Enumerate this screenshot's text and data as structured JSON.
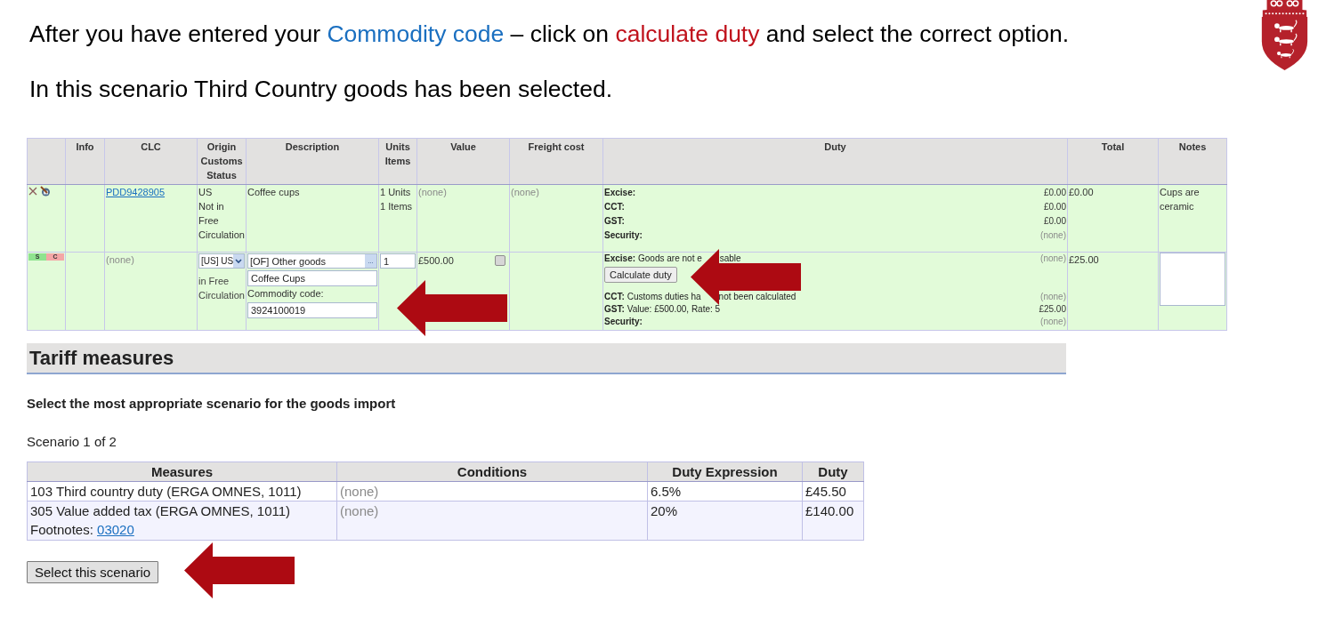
{
  "instructions": [
    {
      "segments": [
        {
          "text": "After you have entered your ",
          "color": "#000000"
        },
        {
          "text": "Commodity code",
          "color": "#1a6fc0"
        },
        {
          "text": " – click on ",
          "color": "#000000"
        },
        {
          "text": "calculate duty",
          "color": "#c0121c"
        },
        {
          "text": " and select the correct option.",
          "color": "#000000"
        }
      ]
    },
    {
      "segments": [
        {
          "text": "In this scenario Third Country goods has been selected.",
          "color": "#000000"
        }
      ]
    }
  ],
  "import_grid": {
    "columns": [
      "Info",
      "CLC",
      "Origin Customs Status",
      "Description",
      "Units Items",
      "Value",
      "Freight cost",
      "Duty",
      "Total",
      "Notes"
    ],
    "rows": [
      {
        "kind": "saved",
        "clc": "PDD9428905",
        "origin_code": "US",
        "origin_status": "Not in Free Circulation",
        "description": "Coffee cups",
        "units": "1 Units",
        "items": "1 Items",
        "value": {
          "text": "(none)",
          "muted": true
        },
        "freight": {
          "text": "(none)",
          "muted": true
        },
        "duty": [
          {
            "kind": "note",
            "label": "Excise:",
            "amount": "£0.00",
            "muted": false
          },
          {
            "kind": "note",
            "label": "CCT:",
            "amount": "£0.00",
            "muted": false
          },
          {
            "kind": "note",
            "label": "GST:",
            "amount": "£0.00",
            "muted": false
          },
          {
            "kind": "note",
            "label": "Security:",
            "amount": "(none)",
            "muted": true
          }
        ],
        "total": "£0.00",
        "notes": "Cups are ceramic"
      },
      {
        "kind": "editing",
        "tags": [
          {
            "letter": "S",
            "color": "#8fe38f"
          },
          {
            "letter": "C",
            "color": "#f4a6a6"
          }
        ],
        "clc": {
          "text": "(none)",
          "muted": true
        },
        "origin_select": "[US] US",
        "origin_status": "in Free Circulation",
        "goods_type_select": "[OF] Other goods",
        "lookup_button": "...",
        "description": "Coffee Cups",
        "commodity_label": "Commodity code:",
        "commodity_code": "3924100019",
        "units": "1",
        "value": "£500.00",
        "value_flag_checked": false,
        "duty": [
          {
            "kind": "note",
            "label": "Excise:",
            "parts": [
              "Goods are not e",
              "sable"
            ],
            "amount": "(none)",
            "muted": true
          },
          {
            "kind": "button",
            "label": "Calculate duty"
          },
          {
            "kind": "note",
            "label": "CCT:",
            "parts": [
              "Customs duties ha",
              "not been calculated"
            ],
            "amount": "(none)",
            "muted": true
          },
          {
            "kind": "note",
            "label": "GST:",
            "parts": [
              "Value: £500.00, Rate: 5"
            ],
            "amount": "£25.00",
            "muted": false
          },
          {
            "kind": "note",
            "label": "Security:",
            "amount": "(none)",
            "muted": true
          }
        ],
        "total": "£25.00"
      }
    ]
  },
  "tariff_measures": {
    "title": "Tariff measures",
    "prompt": "Select the most appropriate scenario for the goods import",
    "scenario": "Scenario 1 of 2",
    "columns": [
      "Measures",
      "Conditions",
      "Duty Expression",
      "Duty"
    ],
    "rows": [
      {
        "measure": "103 Third country duty (ERGA OMNES, 1011)",
        "conditions": {
          "text": "(none)",
          "muted": true
        },
        "duty_expression": "6.5%",
        "duty": "£45.50"
      },
      {
        "measure": "305 Value added tax (ERGA OMNES, 1011)",
        "footnote_label": "Footnotes:",
        "footnote_link": "03020",
        "conditions": {
          "text": "(none)",
          "muted": true
        },
        "duty_expression": "20%",
        "duty": "£140.00"
      }
    ],
    "select_button": "Select this scenario"
  }
}
